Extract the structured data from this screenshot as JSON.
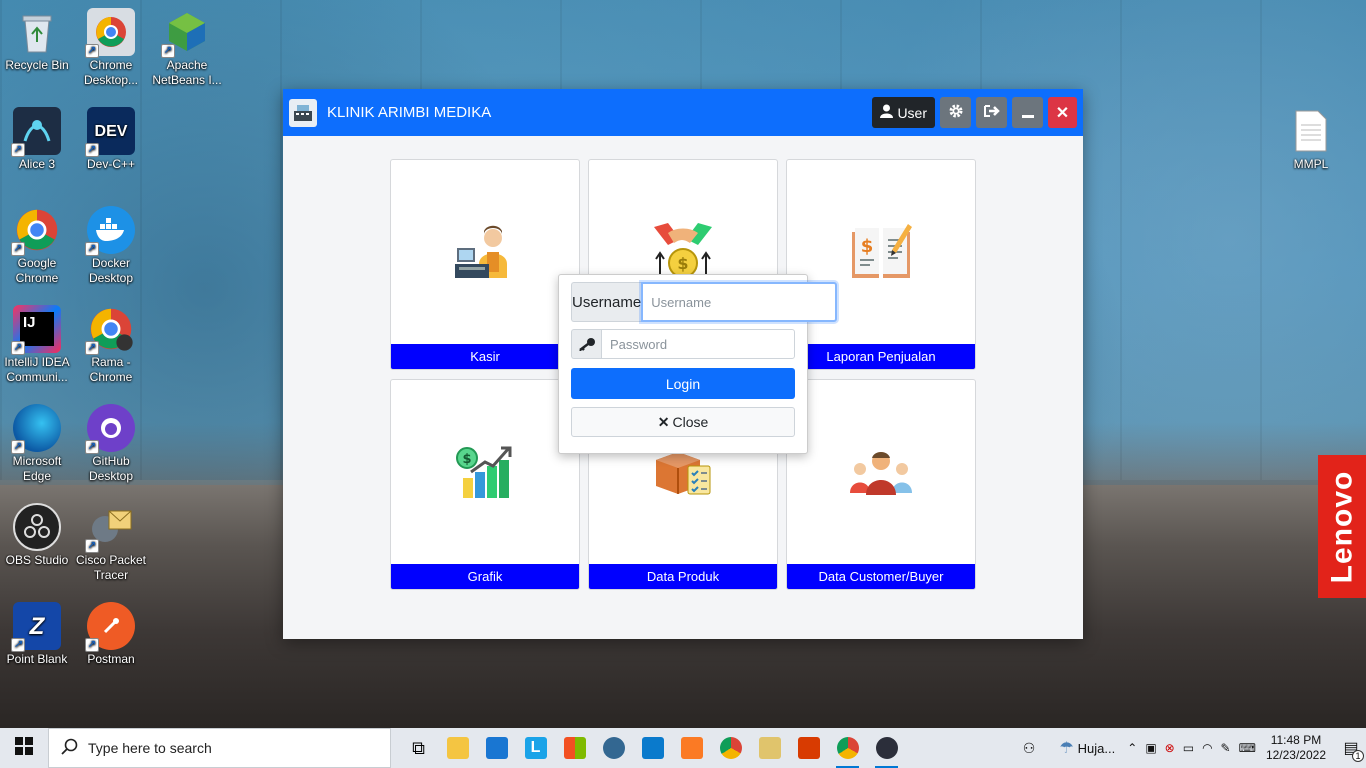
{
  "desktop": {
    "icons_left": [
      {
        "label": "Recycle Bin",
        "icon": "recycle-bin-icon"
      },
      {
        "label": "Chrome Desktop...",
        "icon": "chrome-icon"
      },
      {
        "label": "Apache NetBeans I...",
        "icon": "netbeans-icon"
      },
      {
        "label": "Alice 3",
        "icon": "alice-icon"
      },
      {
        "label": "Dev-C++",
        "icon": "devcpp-icon"
      },
      {
        "label": "Google Chrome",
        "icon": "chrome-icon"
      },
      {
        "label": "Docker Desktop",
        "icon": "docker-icon"
      },
      {
        "label": "IntelliJ IDEA Communi...",
        "icon": "intellij-icon"
      },
      {
        "label": "Rama - Chrome",
        "icon": "chrome-profile-icon"
      },
      {
        "label": "Microsoft Edge",
        "icon": "edge-icon"
      },
      {
        "label": "GitHub Desktop",
        "icon": "github-icon"
      },
      {
        "label": "OBS Studio",
        "icon": "obs-icon"
      },
      {
        "label": "Cisco Packet Tracer",
        "icon": "packet-tracer-icon"
      },
      {
        "label": "Point Blank",
        "icon": "point-blank-icon"
      },
      {
        "label": "Postman",
        "icon": "postman-icon"
      }
    ],
    "file_icon": {
      "label": "MMPL"
    }
  },
  "window": {
    "title": "KLINIK ARIMBI MEDIKA",
    "user_button": "User"
  },
  "cards": [
    {
      "label": "Kasir",
      "icon": "cashier-icon"
    },
    {
      "label": "",
      "icon": "handshake-money-icon"
    },
    {
      "label": "Laporan Penjualan",
      "icon": "report-book-icon"
    },
    {
      "label": "Grafik",
      "icon": "growth-chart-icon"
    },
    {
      "label": "Data Produk",
      "icon": "product-box-icon"
    },
    {
      "label": "Data Customer/Buyer",
      "icon": "customers-icon"
    }
  ],
  "login": {
    "username_label": "Username",
    "username_placeholder": "Username",
    "password_placeholder": "Password",
    "login_button": "Login",
    "close_button": "Close"
  },
  "brand": {
    "lenovo": "Lenovo"
  },
  "taskbar": {
    "search_placeholder": "Type here to search",
    "weather": "Huja...",
    "time": "11:48 PM",
    "date": "12/23/2022",
    "notifications": "1"
  },
  "colors": {
    "primary": "#0d6efd",
    "card_label": "#0000ff",
    "danger": "#dc3545"
  }
}
